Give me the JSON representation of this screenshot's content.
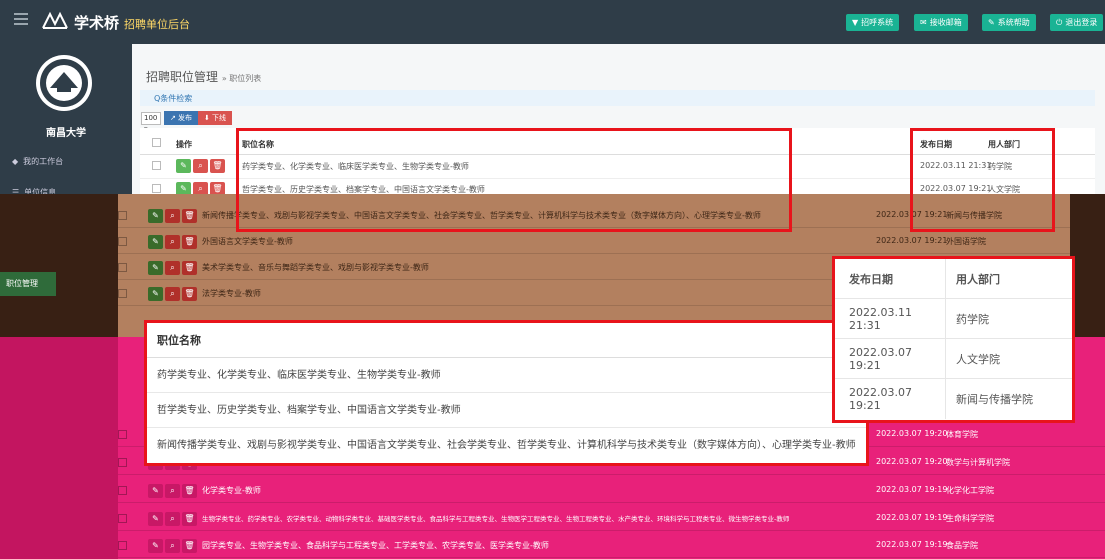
{
  "header": {
    "brand": "学术桥",
    "subtitle": "招聘单位后台",
    "buttons": [
      {
        "label": "招呼系统",
        "color": "#1ab394",
        "icon": "filter-icon"
      },
      {
        "label": "接收邮箱",
        "color": "#1ab394",
        "icon": "envelope-icon"
      },
      {
        "label": "系统帮助",
        "color": "#1ab394",
        "icon": "help-icon"
      },
      {
        "label": "退出登录",
        "color": "#1ab394",
        "icon": "power-icon"
      }
    ]
  },
  "sidebar": {
    "university": "南昌大学",
    "items": [
      {
        "label": "我的工作台",
        "icon": "tag-icon"
      },
      {
        "label": "单位信息",
        "icon": "list-icon"
      }
    ],
    "active_item": "职位管理"
  },
  "breadcrumb": {
    "title": "招聘职位管理",
    "sub": "» 职位列表"
  },
  "filter": {
    "label": "Q条件检索"
  },
  "toolbar": {
    "page_size": "100",
    "publish": "发布",
    "offline": "下线"
  },
  "table": {
    "headers": {
      "op": "操作",
      "name": "职位名称",
      "date": "发布日期",
      "dept": "用人部门"
    },
    "rows": [
      {
        "name": "药学类专业、化学类专业、临床医学类专业、生物学类专业-教师",
        "date": "2022.03.11 21:31",
        "dept": "药学院"
      },
      {
        "name": "哲学类专业、历史学类专业、档案学专业、中国语言文学类专业-教师",
        "date": "2022.03.07 19:21",
        "dept": "人文学院"
      }
    ]
  },
  "overlay_rows_brown": [
    {
      "name": "新闻传播学类专业、戏剧与影视学类专业、中国语言文学类专业、社会学类专业、哲学类专业、计算机科学与技术类专业（数字媒体方向）、心理学类专业-教师",
      "date": "2022.03.07 19:21",
      "dept": "新闻与传播学院"
    },
    {
      "name": "外国语言文学类专业-教师",
      "date": "2022.03.07 19:21",
      "dept": "外国语学院"
    },
    {
      "name": "美术学类专业、音乐与舞蹈学类专业、戏剧与影视学类专业-教师",
      "date": "",
      "dept": ""
    },
    {
      "name": "法学类专业-教师",
      "date": "",
      "dept": ""
    }
  ],
  "overlay_rows_pink": [
    {
      "name": "",
      "date": "2022.03.07 19:20",
      "dept": "体育学院"
    },
    {
      "name": "",
      "date": "2022.03.07 19:20",
      "dept": "数学与计算机学院"
    },
    {
      "name": "化学类专业-教师",
      "date": "2022.03.07 19:19",
      "dept": "化学化工学院"
    },
    {
      "name": "生物学类专业、药学类专业、农学类专业、动物科学类专业、基础医学类专业、食品科学与工程类专业、生物医学工程类专业、生物工程类专业、水产类专业、环境科学与工程类专业、微生物学类专业-教师",
      "date": "2022.03.07 19:19",
      "dept": "生命科学学院"
    },
    {
      "name": "园学类专业、生物学类专业、食品科学与工程类专业、工学类专业、农学类专业、医学类专业-教师",
      "date": "2022.03.07 19:19",
      "dept": "食品学院"
    }
  ],
  "zoom_name": {
    "header": "职位名称",
    "rows": [
      "药学类专业、化学类专业、临床医学类专业、生物学类专业-教师",
      "哲学类专业、历史学类专业、档案学专业、中国语言文学类专业-教师",
      "新闻传播学类专业、戏剧与影视学类专业、中国语言文学类专业、社会学类专业、哲学类专业、计算机科学与技术类专业（数字媒体方向）、心理学类专业-教师"
    ]
  },
  "zoom_date": {
    "header_date": "发布日期",
    "header_dept": "用人部门",
    "rows": [
      {
        "date": "2022.03.11 21:31",
        "dept": "药学院"
      },
      {
        "date": "2022.03.07 19:21",
        "dept": "人文学院"
      },
      {
        "date": "2022.03.07 19:21",
        "dept": "新闻与传播学院"
      }
    ]
  }
}
